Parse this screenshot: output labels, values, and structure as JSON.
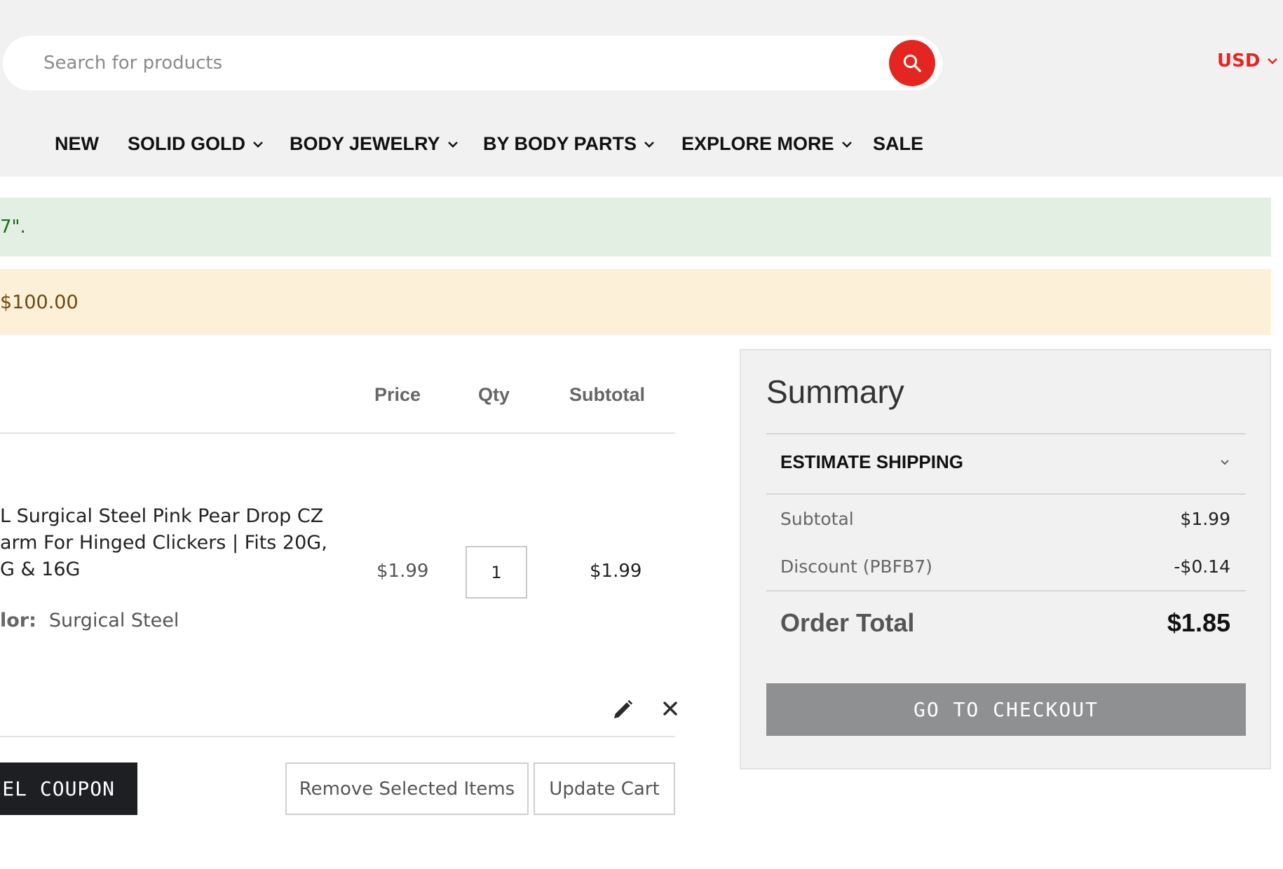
{
  "header": {
    "search": {
      "placeholder": "Search for products",
      "value": ""
    },
    "currency": "USD",
    "nav": [
      {
        "label": "NEW",
        "dropdown": false
      },
      {
        "label": "SOLID GOLD",
        "dropdown": true
      },
      {
        "label": "BODY JEWELRY",
        "dropdown": true
      },
      {
        "label": "BY BODY PARTS",
        "dropdown": true
      },
      {
        "label": "EXPLORE MORE",
        "dropdown": true
      },
      {
        "label": "SALE",
        "dropdown": false
      }
    ]
  },
  "messages": {
    "success": "7\".",
    "notice": "$100.00"
  },
  "cart": {
    "columns": {
      "price": "Price",
      "qty": "Qty",
      "subtotal": "Subtotal"
    },
    "item": {
      "name_lines": [
        "L Surgical Steel Pink Pear Drop CZ",
        "arm For Hinged Clickers | Fits 20G,",
        "G & 16G"
      ],
      "price": "$1.99",
      "qty": "1",
      "subtotal": "$1.99",
      "option_label": "lor:",
      "option_value": "Surgical Steel"
    },
    "actions": {
      "cancel_coupon": "NCEL COUPON",
      "remove_selected": "Remove Selected Items",
      "update_cart": "Update Cart"
    }
  },
  "summary": {
    "title": "Summary",
    "estimate_shipping": "ESTIMATE SHIPPING",
    "subtotal_label": "Subtotal",
    "subtotal_value": "$1.99",
    "discount_label": "Discount (PBFB7)",
    "discount_value": "-$0.14",
    "order_total_label": "Order Total",
    "order_total_value": "$1.85",
    "checkout": "GO TO CHECKOUT"
  },
  "colors": {
    "accent": "#e52620",
    "success_bg": "#e4efe3",
    "notice_bg": "#fdf0d9",
    "dark_button": "#1d1f22",
    "checkout_button": "#8f9091"
  },
  "icons": {
    "search": "search-icon",
    "currency": "chevron-down-icon",
    "nav_dropdown": "chevron-down-icon",
    "edit": "pencil-icon",
    "remove": "close-icon",
    "estimate_shipping": "chevron-down-icon"
  }
}
